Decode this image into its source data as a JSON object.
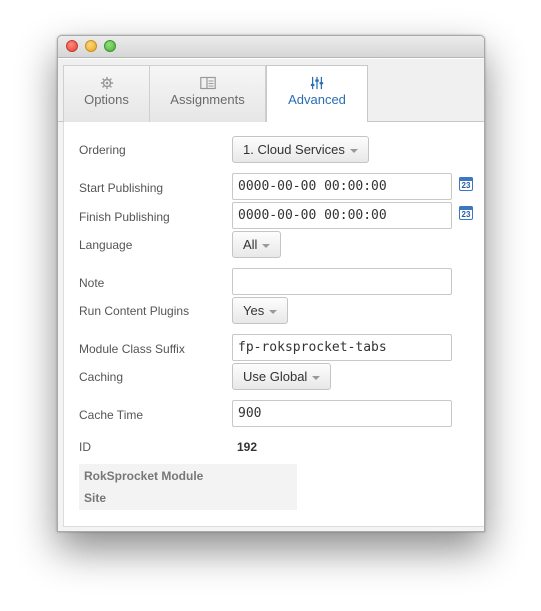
{
  "tabs": [
    {
      "label": "Options",
      "icon": "gear-icon"
    },
    {
      "label": "Assignments",
      "icon": "layout-icon"
    },
    {
      "label": "Advanced",
      "icon": "sliders-icon"
    }
  ],
  "active_tab": "Advanced",
  "fields": {
    "ordering": {
      "label": "Ordering",
      "value": "1. Cloud Services"
    },
    "start_publishing": {
      "label": "Start Publishing",
      "value": "0000-00-00 00:00:00"
    },
    "finish_publishing": {
      "label": "Finish Publishing",
      "value": "0000-00-00 00:00:00"
    },
    "language": {
      "label": "Language",
      "value": "All"
    },
    "note": {
      "label": "Note",
      "value": ""
    },
    "run_content_plugins": {
      "label": "Run Content Plugins",
      "value": "Yes"
    },
    "module_class_suffix": {
      "label": "Module Class Suffix",
      "value": "fp-roksprocket-tabs"
    },
    "caching": {
      "label": "Caching",
      "value": "Use Global"
    },
    "cache_time": {
      "label": "Cache Time",
      "value": "900"
    },
    "id": {
      "label": "ID",
      "value": "192"
    }
  },
  "calendar_day": "23",
  "info": {
    "module": "RokSprocket Module",
    "site": "Site"
  },
  "colors": {
    "active_tab_text": "#2a6db5",
    "calendar_icon": "#3b77c2"
  }
}
